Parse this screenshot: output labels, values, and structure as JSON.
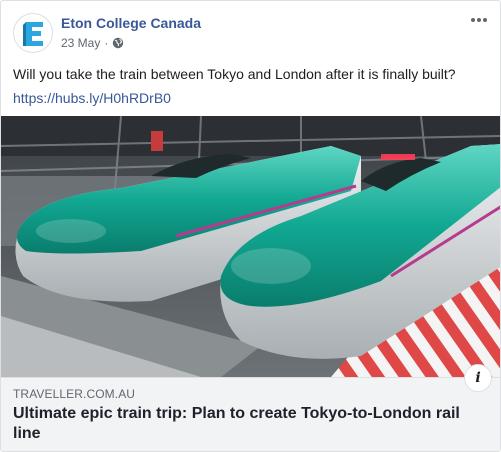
{
  "post": {
    "page_name": "Eton College Canada",
    "date": "23 May",
    "separator": "·",
    "privacy_icon": "globe-icon",
    "more_icon": "more-options-icon",
    "text": "Will you take the train between Tokyo and London after it is finally built?",
    "link": "https://hubs.ly/H0hRDrB0"
  },
  "link_preview": {
    "domain": "TRAVELLER.COM.AU",
    "title": "Ultimate epic train trip: Plan to create Tokyo-to-London rail line",
    "info_icon": "info-icon",
    "info_label": "i"
  },
  "colors": {
    "link": "#385898",
    "train_teal": "#0fa38e",
    "train_silver": "#d7dadc",
    "stripe_red": "#e04848"
  }
}
